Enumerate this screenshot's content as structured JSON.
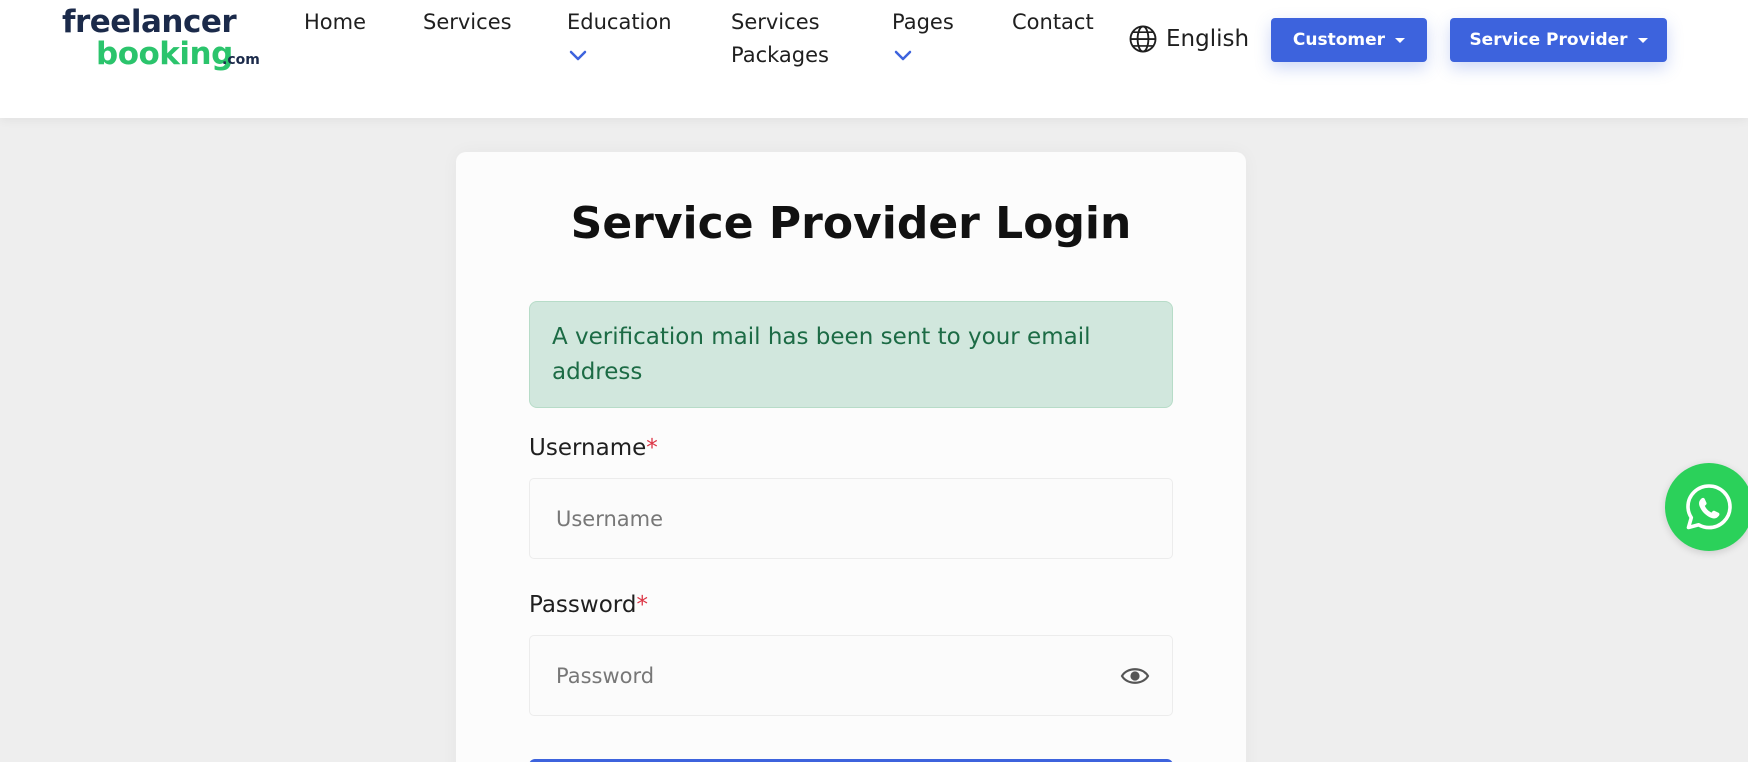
{
  "logo": {
    "line1": "freelancer",
    "line2": "booking",
    "suffix": ".com"
  },
  "nav": {
    "home": "Home",
    "services": "Services",
    "education": "Education",
    "packages_line1": "Services",
    "packages_line2": "Packages",
    "pages": "Pages",
    "contact": "Contact",
    "chevron_icon": "chevron-down-icon"
  },
  "language": {
    "label": "English",
    "icon": "globe-icon"
  },
  "buttons": {
    "customer": "Customer",
    "service_provider": "Service Provider"
  },
  "login": {
    "title": "Service Provider Login",
    "alert": "A verification mail has been sent to your email address",
    "username_label": "Username",
    "username_placeholder": "Username",
    "password_label": "Password",
    "password_placeholder": "Password",
    "required_mark": "*"
  },
  "colors": {
    "accent": "#3d63dd",
    "logo_dark": "#1b2a4a",
    "logo_green": "#2bc46c",
    "alert_bg": "#d1e7dd",
    "alert_text": "#1c6b45",
    "whatsapp": "#2bd15a"
  },
  "floating": {
    "icon": "whatsapp-icon"
  }
}
